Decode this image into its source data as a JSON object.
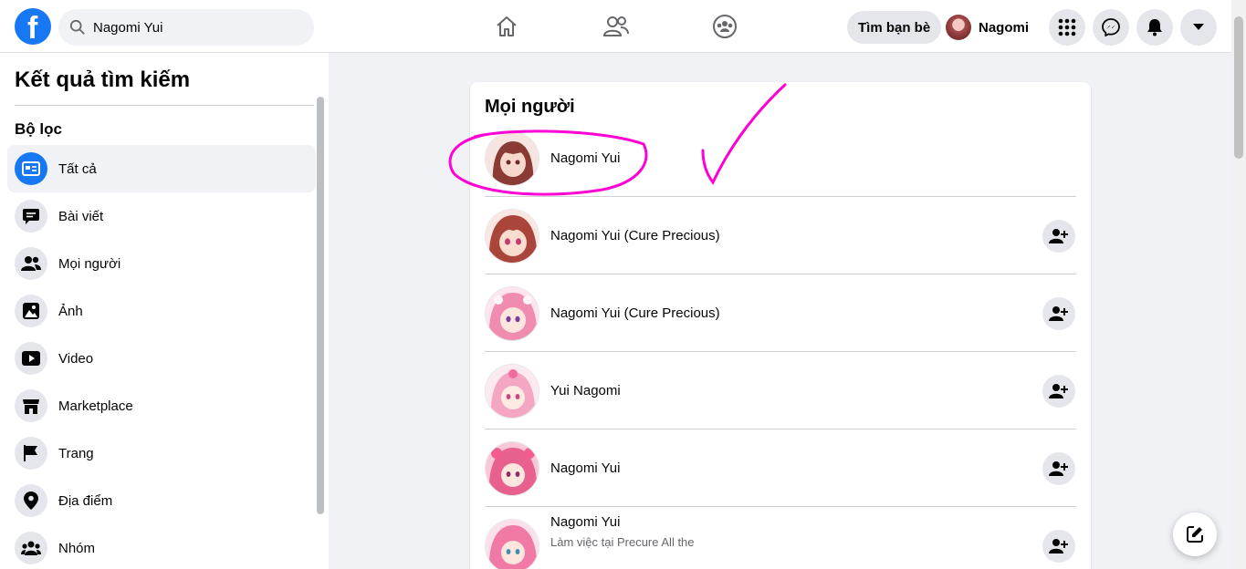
{
  "topbar": {
    "logo_letter": "f",
    "search": {
      "value": "Nagomi Yui"
    },
    "find_friends_label": "Tìm bạn bè",
    "profile_name": "Nagomi"
  },
  "sidebar": {
    "title": "Kết quả tìm kiếm",
    "filter_label": "Bộ lọc",
    "items": [
      {
        "label": "Tất cả",
        "icon": "all-results-icon",
        "active": true
      },
      {
        "label": "Bài viết",
        "icon": "posts-icon"
      },
      {
        "label": "Mọi người",
        "icon": "people-icon"
      },
      {
        "label": "Ảnh",
        "icon": "photos-icon"
      },
      {
        "label": "Video",
        "icon": "video-icon"
      },
      {
        "label": "Marketplace",
        "icon": "marketplace-icon"
      },
      {
        "label": "Trang",
        "icon": "pages-flag-icon"
      },
      {
        "label": "Địa điểm",
        "icon": "location-pin-icon"
      },
      {
        "label": "Nhóm",
        "icon": "groups-icon"
      }
    ]
  },
  "results": {
    "section_title": "Mọi người",
    "people": [
      {
        "name": "Nagomi Yui",
        "add_friend": false,
        "avatar_tone": "#c77a6e"
      },
      {
        "name": "Nagomi Yui (Cure Precious)",
        "add_friend": true,
        "avatar_tone": "#b5534a"
      },
      {
        "name": "Nagomi Yui (Cure Precious)",
        "add_friend": true,
        "avatar_tone": "#f08cb0"
      },
      {
        "name": "Yui Nagomi",
        "add_friend": true,
        "avatar_tone": "#f4a6c3"
      },
      {
        "name": "Nagomi Yui",
        "add_friend": true,
        "avatar_tone": "#e8608e"
      },
      {
        "name": "Nagomi Yui",
        "subtitle": "Làm việc tại Precure All the",
        "add_friend": true,
        "avatar_tone": "#f07aa5"
      }
    ]
  },
  "colors": {
    "brand_blue": "#1877f2",
    "annotation_magenta": "#ff00d4"
  }
}
